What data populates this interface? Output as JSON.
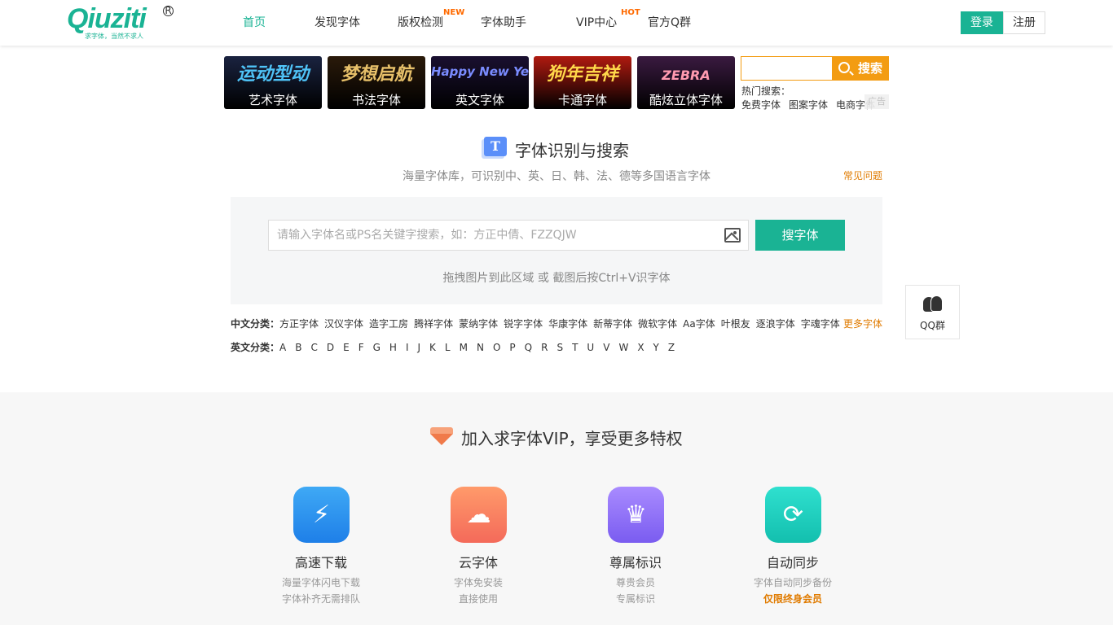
{
  "header": {
    "logo_text": "Qiuziti",
    "logo_sub": "求字体，当然不求人",
    "logo_reg": "R",
    "nav": [
      {
        "label": "首页",
        "badge": ""
      },
      {
        "label": "发现字体",
        "badge": ""
      },
      {
        "label": "版权检测",
        "badge": "NEW"
      },
      {
        "label": "字体助手",
        "badge": ""
      },
      {
        "label": "VIP中心",
        "badge": "HOT"
      },
      {
        "label": "官方Q群",
        "badge": ""
      }
    ],
    "login": "登录",
    "register": "注册"
  },
  "banners": [
    {
      "art": "运动型动",
      "label": "艺术字体",
      "bg": "#1a2340",
      "art_color": "#4fc3f7"
    },
    {
      "art": "梦想启航",
      "label": "书法字体",
      "bg": "#2a1a0a",
      "art_color": "#e8c16a"
    },
    {
      "art": "Happy New Year",
      "label": "英文字体",
      "bg": "#1a1030",
      "art_color": "#7a8cff"
    },
    {
      "art": "狗年吉祥",
      "label": "卡通字体",
      "bg": "#b01a10",
      "art_color": "#ffd84a"
    },
    {
      "art": "ZEBRA",
      "label": "酷炫立体字体",
      "bg": "#3a1a40",
      "art_color": "#ff9ab0"
    }
  ],
  "side_search": {
    "button": "搜索",
    "hot_title": "热门搜索：",
    "hot_tags": [
      "免费字体",
      "图案字体",
      "电商字体"
    ],
    "ad": "广告"
  },
  "identify": {
    "icon_letter": "T",
    "title": "字体识别与搜索",
    "subtitle": "海量字体库，可识别中、英、日、韩、法、德等多国语言字体",
    "faq": "常见问题",
    "placeholder": "请输入字体名或PS名关键字搜索，如：方正中倩、FZZQJW",
    "search_button": "搜字体",
    "drag_hint": "拖拽图片到此区域 或 截图后按Ctrl+V识字体"
  },
  "categories": {
    "cn_label": "中文分类：",
    "cn_items": [
      "方正字体",
      "汉仪字体",
      "造字工房",
      "腾祥字体",
      "蒙纳字体",
      "锐字字体",
      "华康字体",
      "新蒂字体",
      "微软字体",
      "Aa字体",
      "叶根友",
      "逐浪字体",
      "字魂字体"
    ],
    "more": "更多字体",
    "en_label": "英文分类：",
    "en_items": [
      "A",
      "B",
      "C",
      "D",
      "E",
      "F",
      "G",
      "H",
      "I",
      "J",
      "K",
      "L",
      "M",
      "N",
      "O",
      "P",
      "Q",
      "R",
      "S",
      "T",
      "U",
      "V",
      "W",
      "X",
      "Y",
      "Z"
    ]
  },
  "qq_float": {
    "label": "QQ群"
  },
  "vip": {
    "title": "加入求字体VIP，享受更多特权",
    "features": [
      {
        "name": "高速下载",
        "d1": "海量字体闪电下载",
        "d2": "字体补齐无需排队",
        "icon": "lightning-icon",
        "glyph": "⚡",
        "c1": "#3fa9f5",
        "c2": "#1e7fe8"
      },
      {
        "name": "云字体",
        "d1": "字体免安装",
        "d2": "直接使用",
        "icon": "cloud-icon",
        "glyph": "☁",
        "c1": "#ff9a6a",
        "c2": "#f46a5a"
      },
      {
        "name": "尊属标识",
        "d1": "尊贵会员",
        "d2": "专属标识",
        "icon": "crown-icon",
        "glyph": "♛",
        "c1": "#a98bff",
        "c2": "#7a5cf0"
      },
      {
        "name": "自动同步",
        "d1": "字体自动同步备份",
        "d2": "仅限终身会员",
        "icon": "sync-icon",
        "glyph": "⟳",
        "c1": "#2fe0cf",
        "c2": "#13bfae"
      }
    ]
  },
  "colors": {
    "brand": "#1ab394",
    "accent": "#e07b00",
    "orange": "#f39c12"
  }
}
